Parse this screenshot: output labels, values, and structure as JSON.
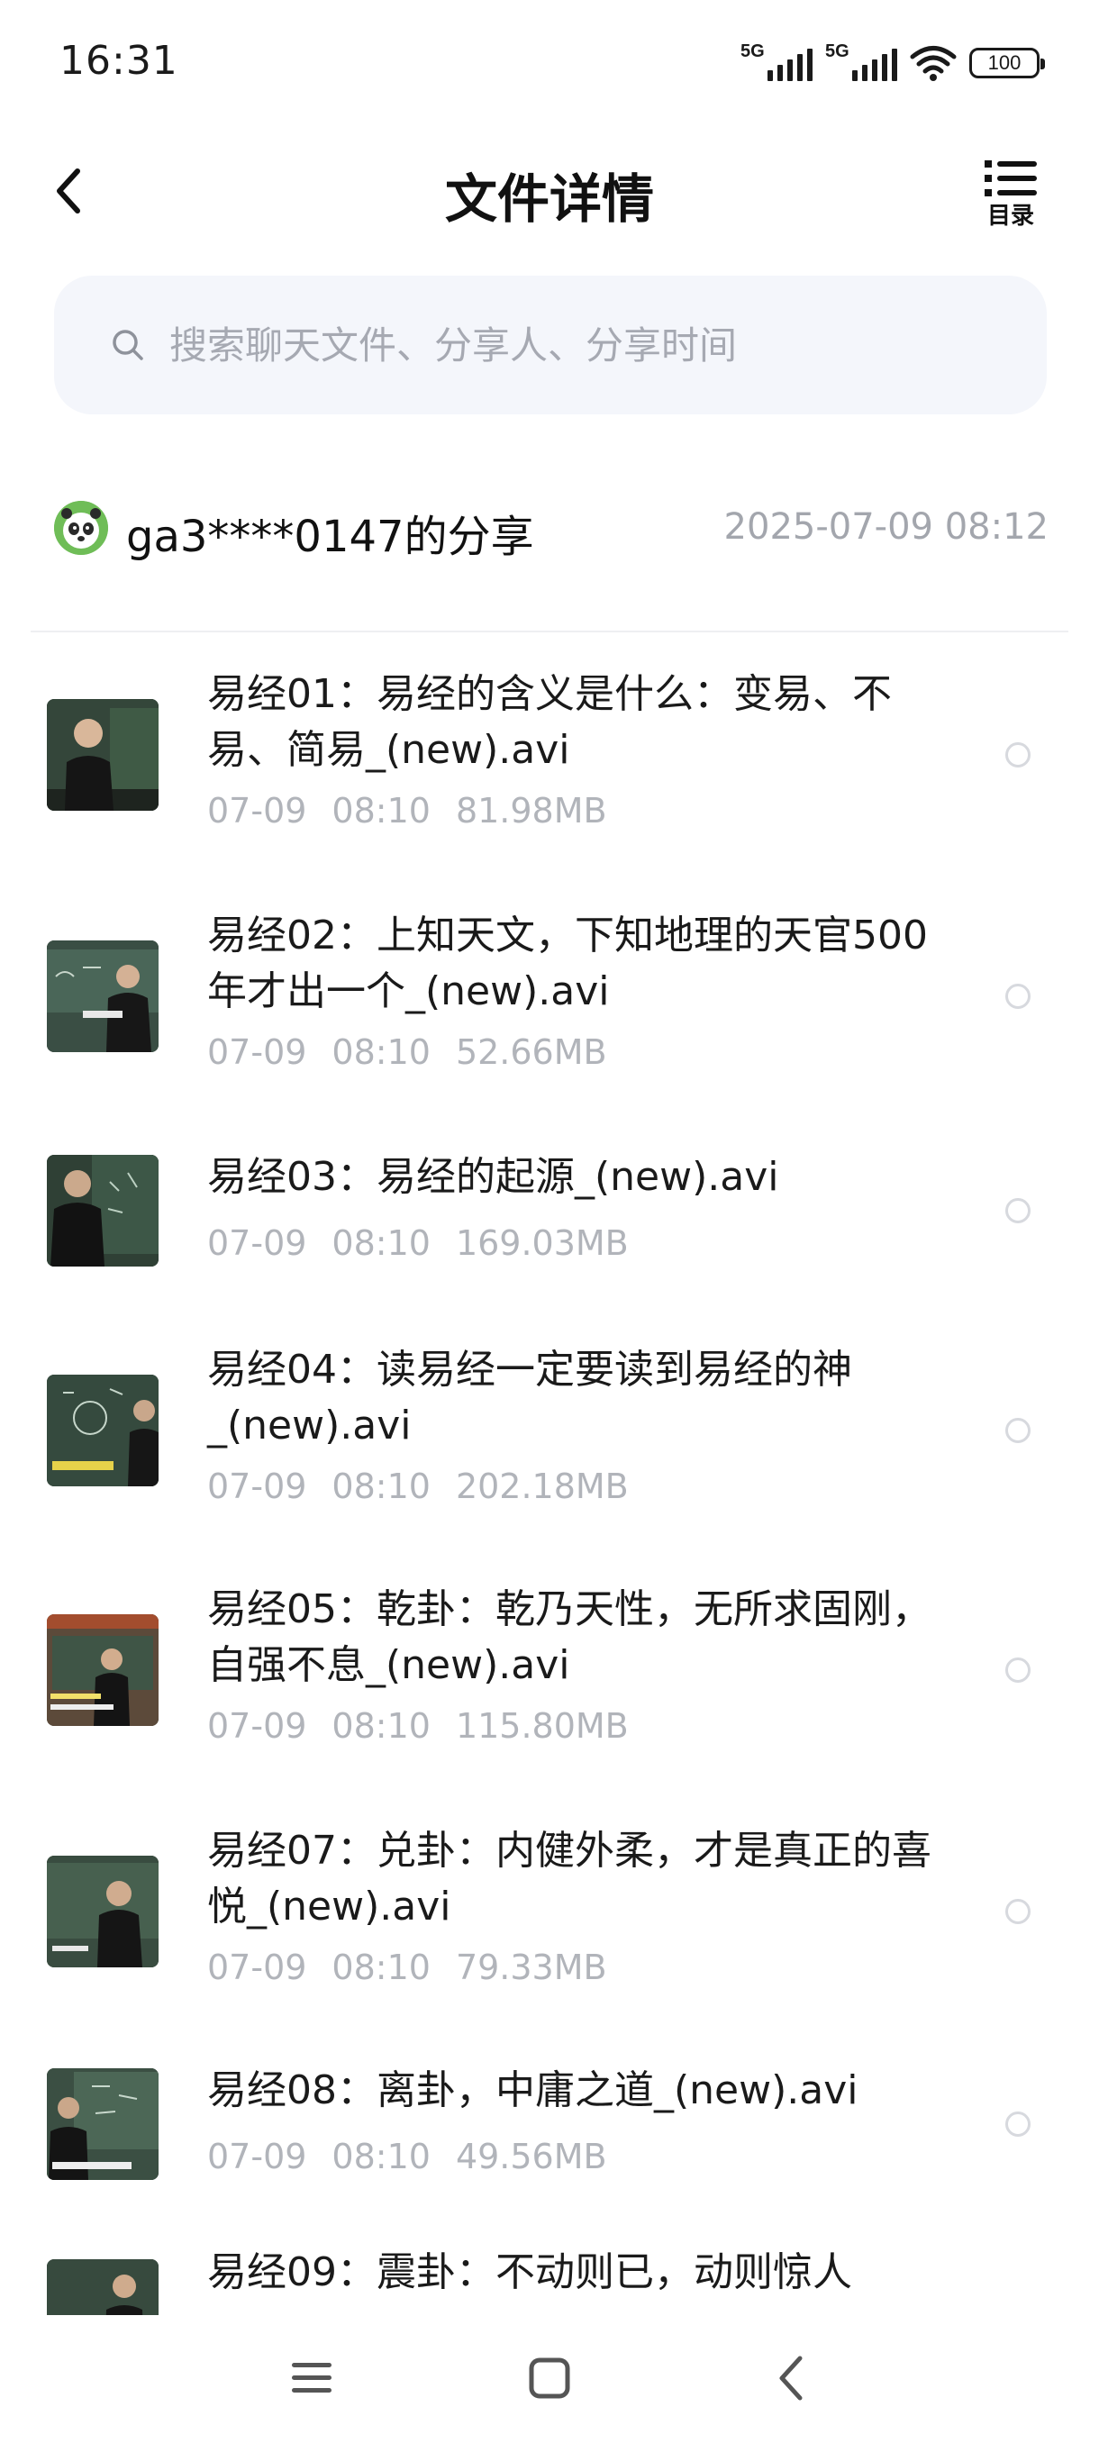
{
  "status_bar": {
    "time": "16:31",
    "signal_1_label": "5G",
    "signal_2_label": "5G",
    "battery_level": "100"
  },
  "header": {
    "title": "文件详情",
    "back_icon": "chevron-left-icon",
    "toc_icon": "list-icon",
    "toc_label": "目录"
  },
  "search": {
    "placeholder": "搜索聊天文件、分享人、分享时间",
    "value": "",
    "icon": "search-icon"
  },
  "share": {
    "sharer": "ga3****0147的分享",
    "time": "2025-07-09  08:12"
  },
  "files": [
    {
      "name": "易经01：易经的含义是什么：变易、不易、简易_(new).avi",
      "date": "07-09",
      "time": "08:10",
      "size": "81.98MB"
    },
    {
      "name": "易经02：上知天文，下知地理的天官500年才出一个_(new).avi",
      "date": "07-09",
      "time": "08:10",
      "size": "52.66MB"
    },
    {
      "name": "易经03：易经的起源_(new).avi",
      "date": "07-09",
      "time": "08:10",
      "size": "169.03MB"
    },
    {
      "name": "易经04：读易经一定要读到易经的神_(new).avi",
      "date": "07-09",
      "time": "08:10",
      "size": "202.18MB"
    },
    {
      "name": "易经05：乾卦：乾乃天性，无所求固刚，自强不息_(new).avi",
      "date": "07-09",
      "time": "08:10",
      "size": "115.80MB"
    },
    {
      "name": "易经07：兑卦：内健外柔，才是真正的喜悦_(new).avi",
      "date": "07-09",
      "time": "08:10",
      "size": "79.33MB"
    },
    {
      "name": "易经08：离卦，中庸之道_(new).avi",
      "date": "07-09",
      "time": "08:10",
      "size": "49.56MB"
    },
    {
      "name": "易经09：震卦：不动则已，动则惊人",
      "date": "",
      "time": "",
      "size": ""
    }
  ],
  "nav": {
    "menu_icon": "menu-icon",
    "home_icon": "home-square-icon",
    "back_icon": "back-triangle-icon"
  },
  "colors": {
    "accent_text": "#1a1a1a",
    "meta_text": "#b1b4ba",
    "search_bg": "#f4f6fb"
  }
}
